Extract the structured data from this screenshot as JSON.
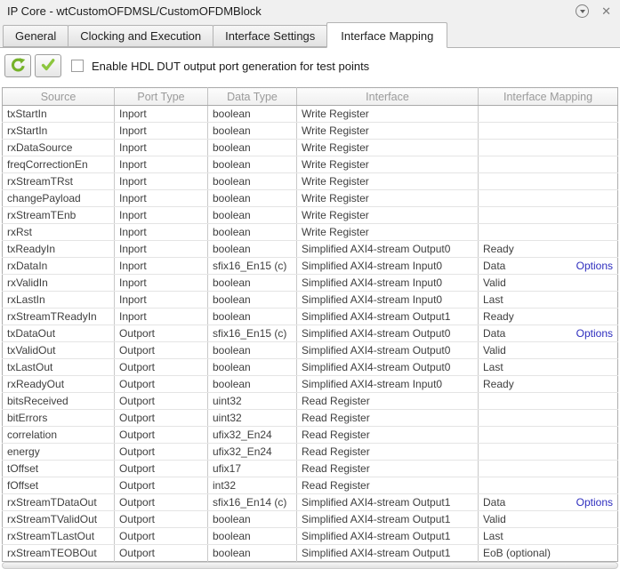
{
  "window": {
    "title": "IP Core - wtCustomOFDMSL/CustomOFDMBlock",
    "close_glyph": "✕"
  },
  "tabs": [
    {
      "label": "General",
      "active": false
    },
    {
      "label": "Clocking and Execution",
      "active": false
    },
    {
      "label": "Interface Settings",
      "active": false
    },
    {
      "label": "Interface Mapping",
      "active": true
    }
  ],
  "toolbar": {
    "buttons": [
      {
        "name": "refresh",
        "icon": "refresh-arrow-icon"
      },
      {
        "name": "validate",
        "icon": "green-checkmark-icon"
      }
    ],
    "checkbox": {
      "label": "Enable HDL DUT output port generation for test points",
      "checked": false
    }
  },
  "table": {
    "columns": [
      "Source",
      "Port Type",
      "Data Type",
      "Interface",
      "Interface Mapping"
    ],
    "options_label": "Options",
    "rows": [
      {
        "source": "txStartIn",
        "port_type": "Inport",
        "data_type": "boolean",
        "interface": "Write Register",
        "mapping": "",
        "options": false
      },
      {
        "source": "rxStartIn",
        "port_type": "Inport",
        "data_type": "boolean",
        "interface": "Write Register",
        "mapping": "",
        "options": false
      },
      {
        "source": "rxDataSource",
        "port_type": "Inport",
        "data_type": "boolean",
        "interface": "Write Register",
        "mapping": "",
        "options": false
      },
      {
        "source": "freqCorrectionEn",
        "port_type": "Inport",
        "data_type": "boolean",
        "interface": "Write Register",
        "mapping": "",
        "options": false
      },
      {
        "source": "rxStreamTRst",
        "port_type": "Inport",
        "data_type": "boolean",
        "interface": "Write Register",
        "mapping": "",
        "options": false
      },
      {
        "source": "changePayload",
        "port_type": "Inport",
        "data_type": "boolean",
        "interface": "Write Register",
        "mapping": "",
        "options": false
      },
      {
        "source": "rxStreamTEnb",
        "port_type": "Inport",
        "data_type": "boolean",
        "interface": "Write Register",
        "mapping": "",
        "options": false
      },
      {
        "source": "rxRst",
        "port_type": "Inport",
        "data_type": "boolean",
        "interface": "Write Register",
        "mapping": "",
        "options": false
      },
      {
        "source": "txReadyIn",
        "port_type": "Inport",
        "data_type": "boolean",
        "interface": "Simplified AXI4-stream Output0",
        "mapping": "Ready",
        "options": false
      },
      {
        "source": "rxDataIn",
        "port_type": "Inport",
        "data_type": "sfix16_En15 (c)",
        "interface": "Simplified AXI4-stream Input0",
        "mapping": "Data",
        "options": true
      },
      {
        "source": "rxValidIn",
        "port_type": "Inport",
        "data_type": "boolean",
        "interface": "Simplified AXI4-stream Input0",
        "mapping": "Valid",
        "options": false
      },
      {
        "source": "rxLastIn",
        "port_type": "Inport",
        "data_type": "boolean",
        "interface": "Simplified AXI4-stream Input0",
        "mapping": "Last",
        "options": false
      },
      {
        "source": "rxStreamTReadyIn",
        "port_type": "Inport",
        "data_type": "boolean",
        "interface": "Simplified AXI4-stream Output1",
        "mapping": "Ready",
        "options": false
      },
      {
        "source": "txDataOut",
        "port_type": "Outport",
        "data_type": "sfix16_En15 (c)",
        "interface": "Simplified AXI4-stream Output0",
        "mapping": "Data",
        "options": true
      },
      {
        "source": "txValidOut",
        "port_type": "Outport",
        "data_type": "boolean",
        "interface": "Simplified AXI4-stream Output0",
        "mapping": "Valid",
        "options": false
      },
      {
        "source": "txLastOut",
        "port_type": "Outport",
        "data_type": "boolean",
        "interface": "Simplified AXI4-stream Output0",
        "mapping": "Last",
        "options": false
      },
      {
        "source": "rxReadyOut",
        "port_type": "Outport",
        "data_type": "boolean",
        "interface": "Simplified AXI4-stream Input0",
        "mapping": "Ready",
        "options": false
      },
      {
        "source": "bitsReceived",
        "port_type": "Outport",
        "data_type": "uint32",
        "interface": "Read Register",
        "mapping": "",
        "options": false
      },
      {
        "source": "bitErrors",
        "port_type": "Outport",
        "data_type": "uint32",
        "interface": "Read Register",
        "mapping": "",
        "options": false
      },
      {
        "source": "correlation",
        "port_type": "Outport",
        "data_type": "ufix32_En24",
        "interface": "Read Register",
        "mapping": "",
        "options": false
      },
      {
        "source": "energy",
        "port_type": "Outport",
        "data_type": "ufix32_En24",
        "interface": "Read Register",
        "mapping": "",
        "options": false
      },
      {
        "source": "tOffset",
        "port_type": "Outport",
        "data_type": "ufix17",
        "interface": "Read Register",
        "mapping": "",
        "options": false
      },
      {
        "source": "fOffset",
        "port_type": "Outport",
        "data_type": "int32",
        "interface": "Read Register",
        "mapping": "",
        "options": false
      },
      {
        "source": "rxStreamTDataOut",
        "port_type": "Outport",
        "data_type": "sfix16_En14 (c)",
        "interface": "Simplified AXI4-stream Output1",
        "mapping": "Data",
        "options": true
      },
      {
        "source": "rxStreamTValidOut",
        "port_type": "Outport",
        "data_type": "boolean",
        "interface": "Simplified AXI4-stream Output1",
        "mapping": "Valid",
        "options": false
      },
      {
        "source": "rxStreamTLastOut",
        "port_type": "Outport",
        "data_type": "boolean",
        "interface": "Simplified AXI4-stream Output1",
        "mapping": "Last",
        "options": false
      },
      {
        "source": "rxStreamTEOBOut",
        "port_type": "Outport",
        "data_type": "boolean",
        "interface": "Simplified AXI4-stream Output1",
        "mapping": "EoB (optional)",
        "options": false
      }
    ]
  },
  "colors": {
    "accent_green": "#76b82a",
    "link_blue": "#2d2dbe",
    "header_text": "#9b9b9b"
  }
}
